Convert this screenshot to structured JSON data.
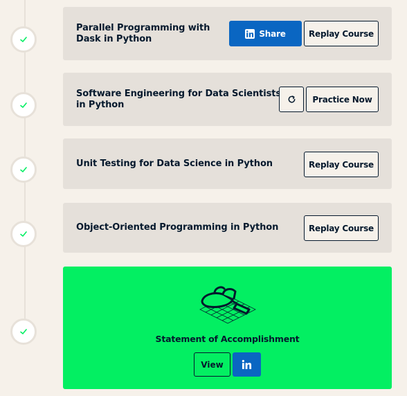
{
  "courses": [
    {
      "title_line1": "Parallel Programming with",
      "title_line2": "Dask in Python",
      "share_label": "Share",
      "action_label": "Replay Course"
    },
    {
      "title_line1": "Software Engineering for Data Scientists",
      "title_line2": "in Python",
      "action_label": "Practice Now"
    },
    {
      "title_line1": "Unit Testing for Data Science in Python",
      "action_label": "Replay Course"
    },
    {
      "title_line1": "Object-Oriented Programming in Python",
      "action_label": "Replay Course"
    }
  ],
  "accomplishment": {
    "title": "Statement of Accomplishment",
    "view_label": "View"
  },
  "icons": {
    "timeline": "check-icon",
    "share": "linkedin-icon",
    "retry": "refresh-icon",
    "accomplishment": "trophy-icon"
  },
  "colors": {
    "background": "#f6f1ea",
    "card": "#e5e0da",
    "accent_green": "#03ef62",
    "check_green": "#03ef62",
    "linkedin_blue": "#0a66c2",
    "text_dark": "#05192d"
  }
}
